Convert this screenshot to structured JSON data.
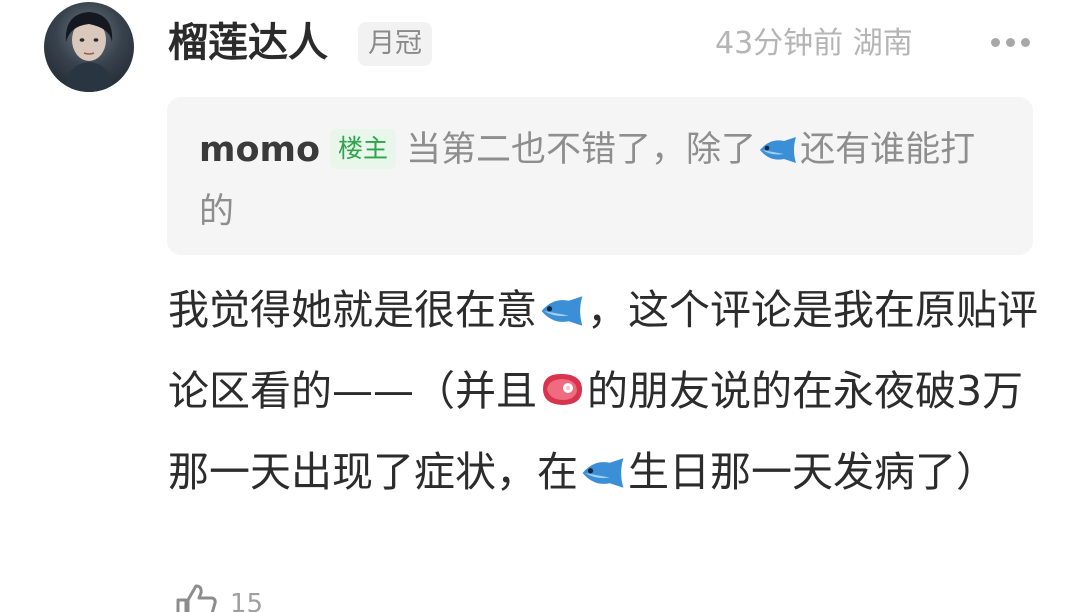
{
  "comment": {
    "username": "榴莲达人",
    "fan_badge": "月冠",
    "meta": "43分钟前 湖南",
    "more_icon": "more-icon",
    "quote": {
      "author": "momo",
      "op_badge": "楼主",
      "text_before_emoji": "当第二也不错了，除了",
      "emoji": "fish-emoji",
      "text_after_emoji": "还有谁能打的"
    },
    "body": {
      "part1": "我觉得她就是很在意",
      "part2": "，这个评论是我在原贴评论区看的——（并且",
      "part3": "的朋友说的在永夜破3万那一天出现了症状，在",
      "part4": "生日那一天发病了）",
      "emoji_fish": "fish-emoji",
      "emoji_meat": "meat-emoji"
    },
    "likes": "15",
    "like_icon": "thumbs-up-icon"
  }
}
